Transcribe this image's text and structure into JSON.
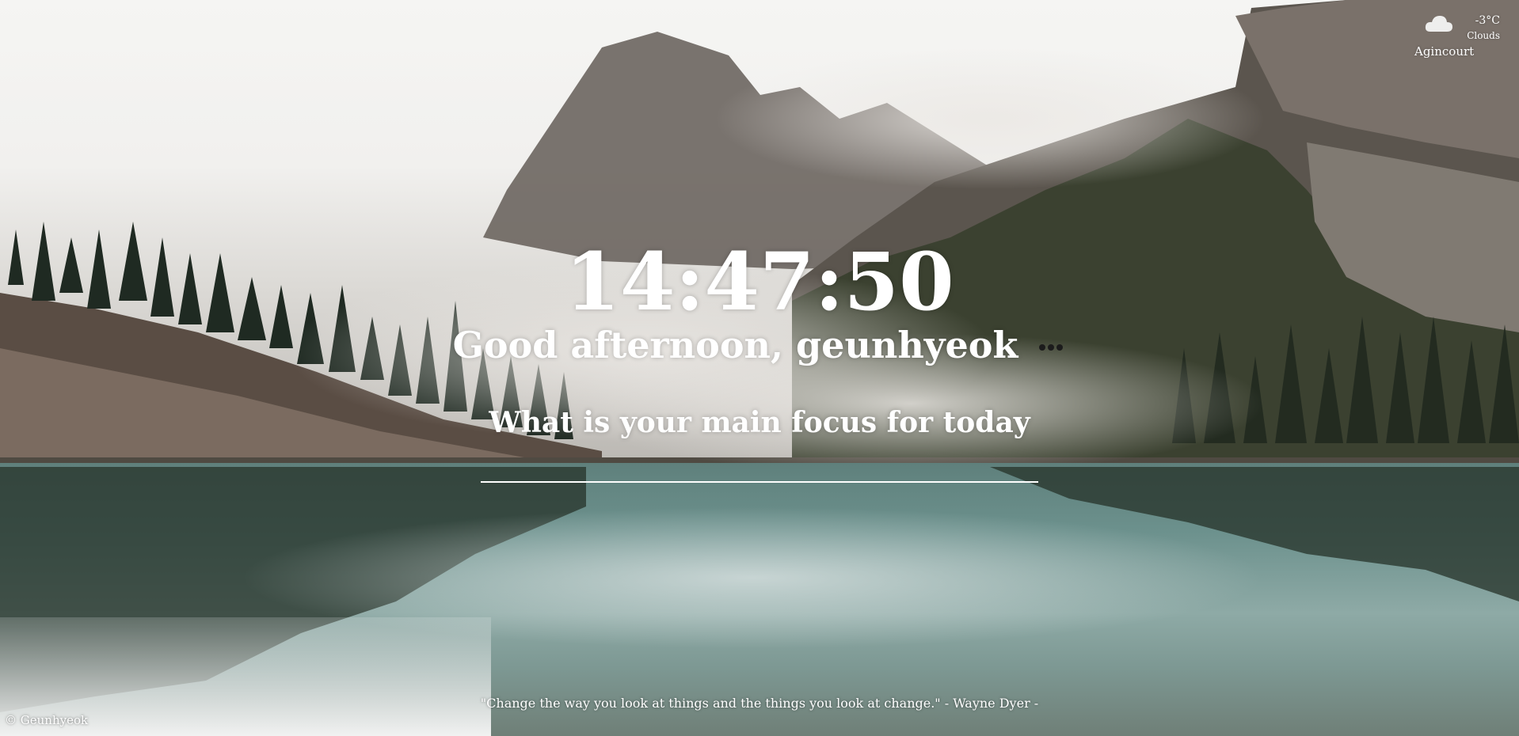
{
  "weather": {
    "icon": "cloud-icon",
    "temperature": "-3°C",
    "condition": "Clouds",
    "city": "Agincourt"
  },
  "clock": {
    "time": "14:47:50"
  },
  "greeting": {
    "text": "Good afternoon, geunhyeok",
    "menu_icon": "more-dots-icon"
  },
  "focus": {
    "question": "What is your main focus for today",
    "value": ""
  },
  "quote": {
    "text": "\"Change the way you look at things and the things you look at change.\" - Wayne Dyer -"
  },
  "footer": {
    "copyright": "© Geunhyeok"
  },
  "colors": {
    "text": "#ffffff",
    "menu_dots": "#1c1c1c",
    "input_underline": "#ffffff"
  }
}
